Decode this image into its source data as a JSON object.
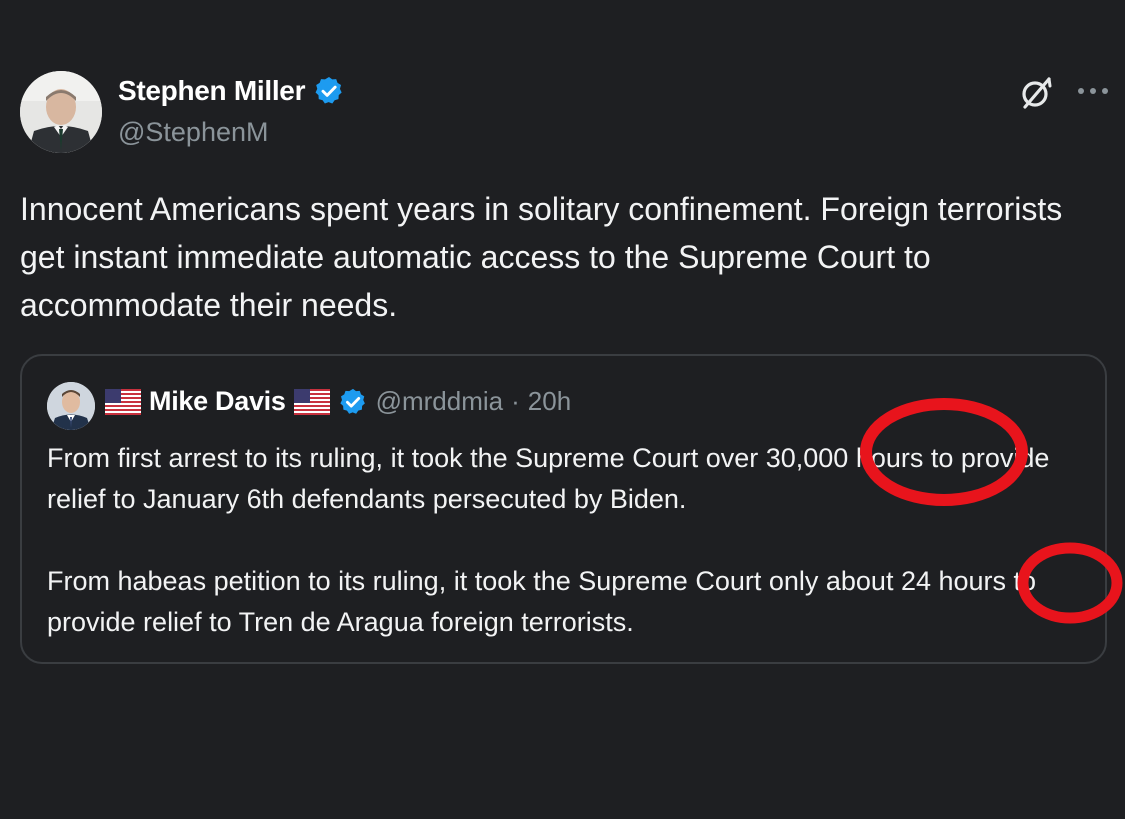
{
  "post": {
    "author_name": "Stephen Miller",
    "author_handle": "@StephenM",
    "text": "Innocent Americans spent years in solitary confinement. Foreign terrorists get instant immediate automatic access to the Supreme Court to accommodate their needs.",
    "icons": {
      "verified": "verified-badge-icon",
      "grok": "grok-icon",
      "more": "more-options-icon"
    }
  },
  "quote": {
    "author_name": "Mike Davis",
    "author_handle": "@mrddmia",
    "separator": "·",
    "timestamp": "20h",
    "paragraph_1": "From first arrest to its ruling, it took the Supreme Court over 30,000 hours to provide relief to January 6th defendants persecuted by Biden.",
    "paragraph_2": "From habeas petition to its ruling, it took the Supreme Court only about 24 hours to provide relief to Tren de Aragua foreign terrorists.",
    "icons": {
      "flag": "us-flag-icon",
      "verified": "verified-badge-icon"
    }
  },
  "annotations": {
    "circle_color": "#e8141c",
    "circled_values": [
      "30,000",
      "24"
    ]
  },
  "colors": {
    "background": "#1e1f22",
    "text": "#f2f3f4",
    "secondary_text": "#8b949a",
    "verified_blue": "#1d9bf0",
    "card_border": "#3a3d41"
  }
}
